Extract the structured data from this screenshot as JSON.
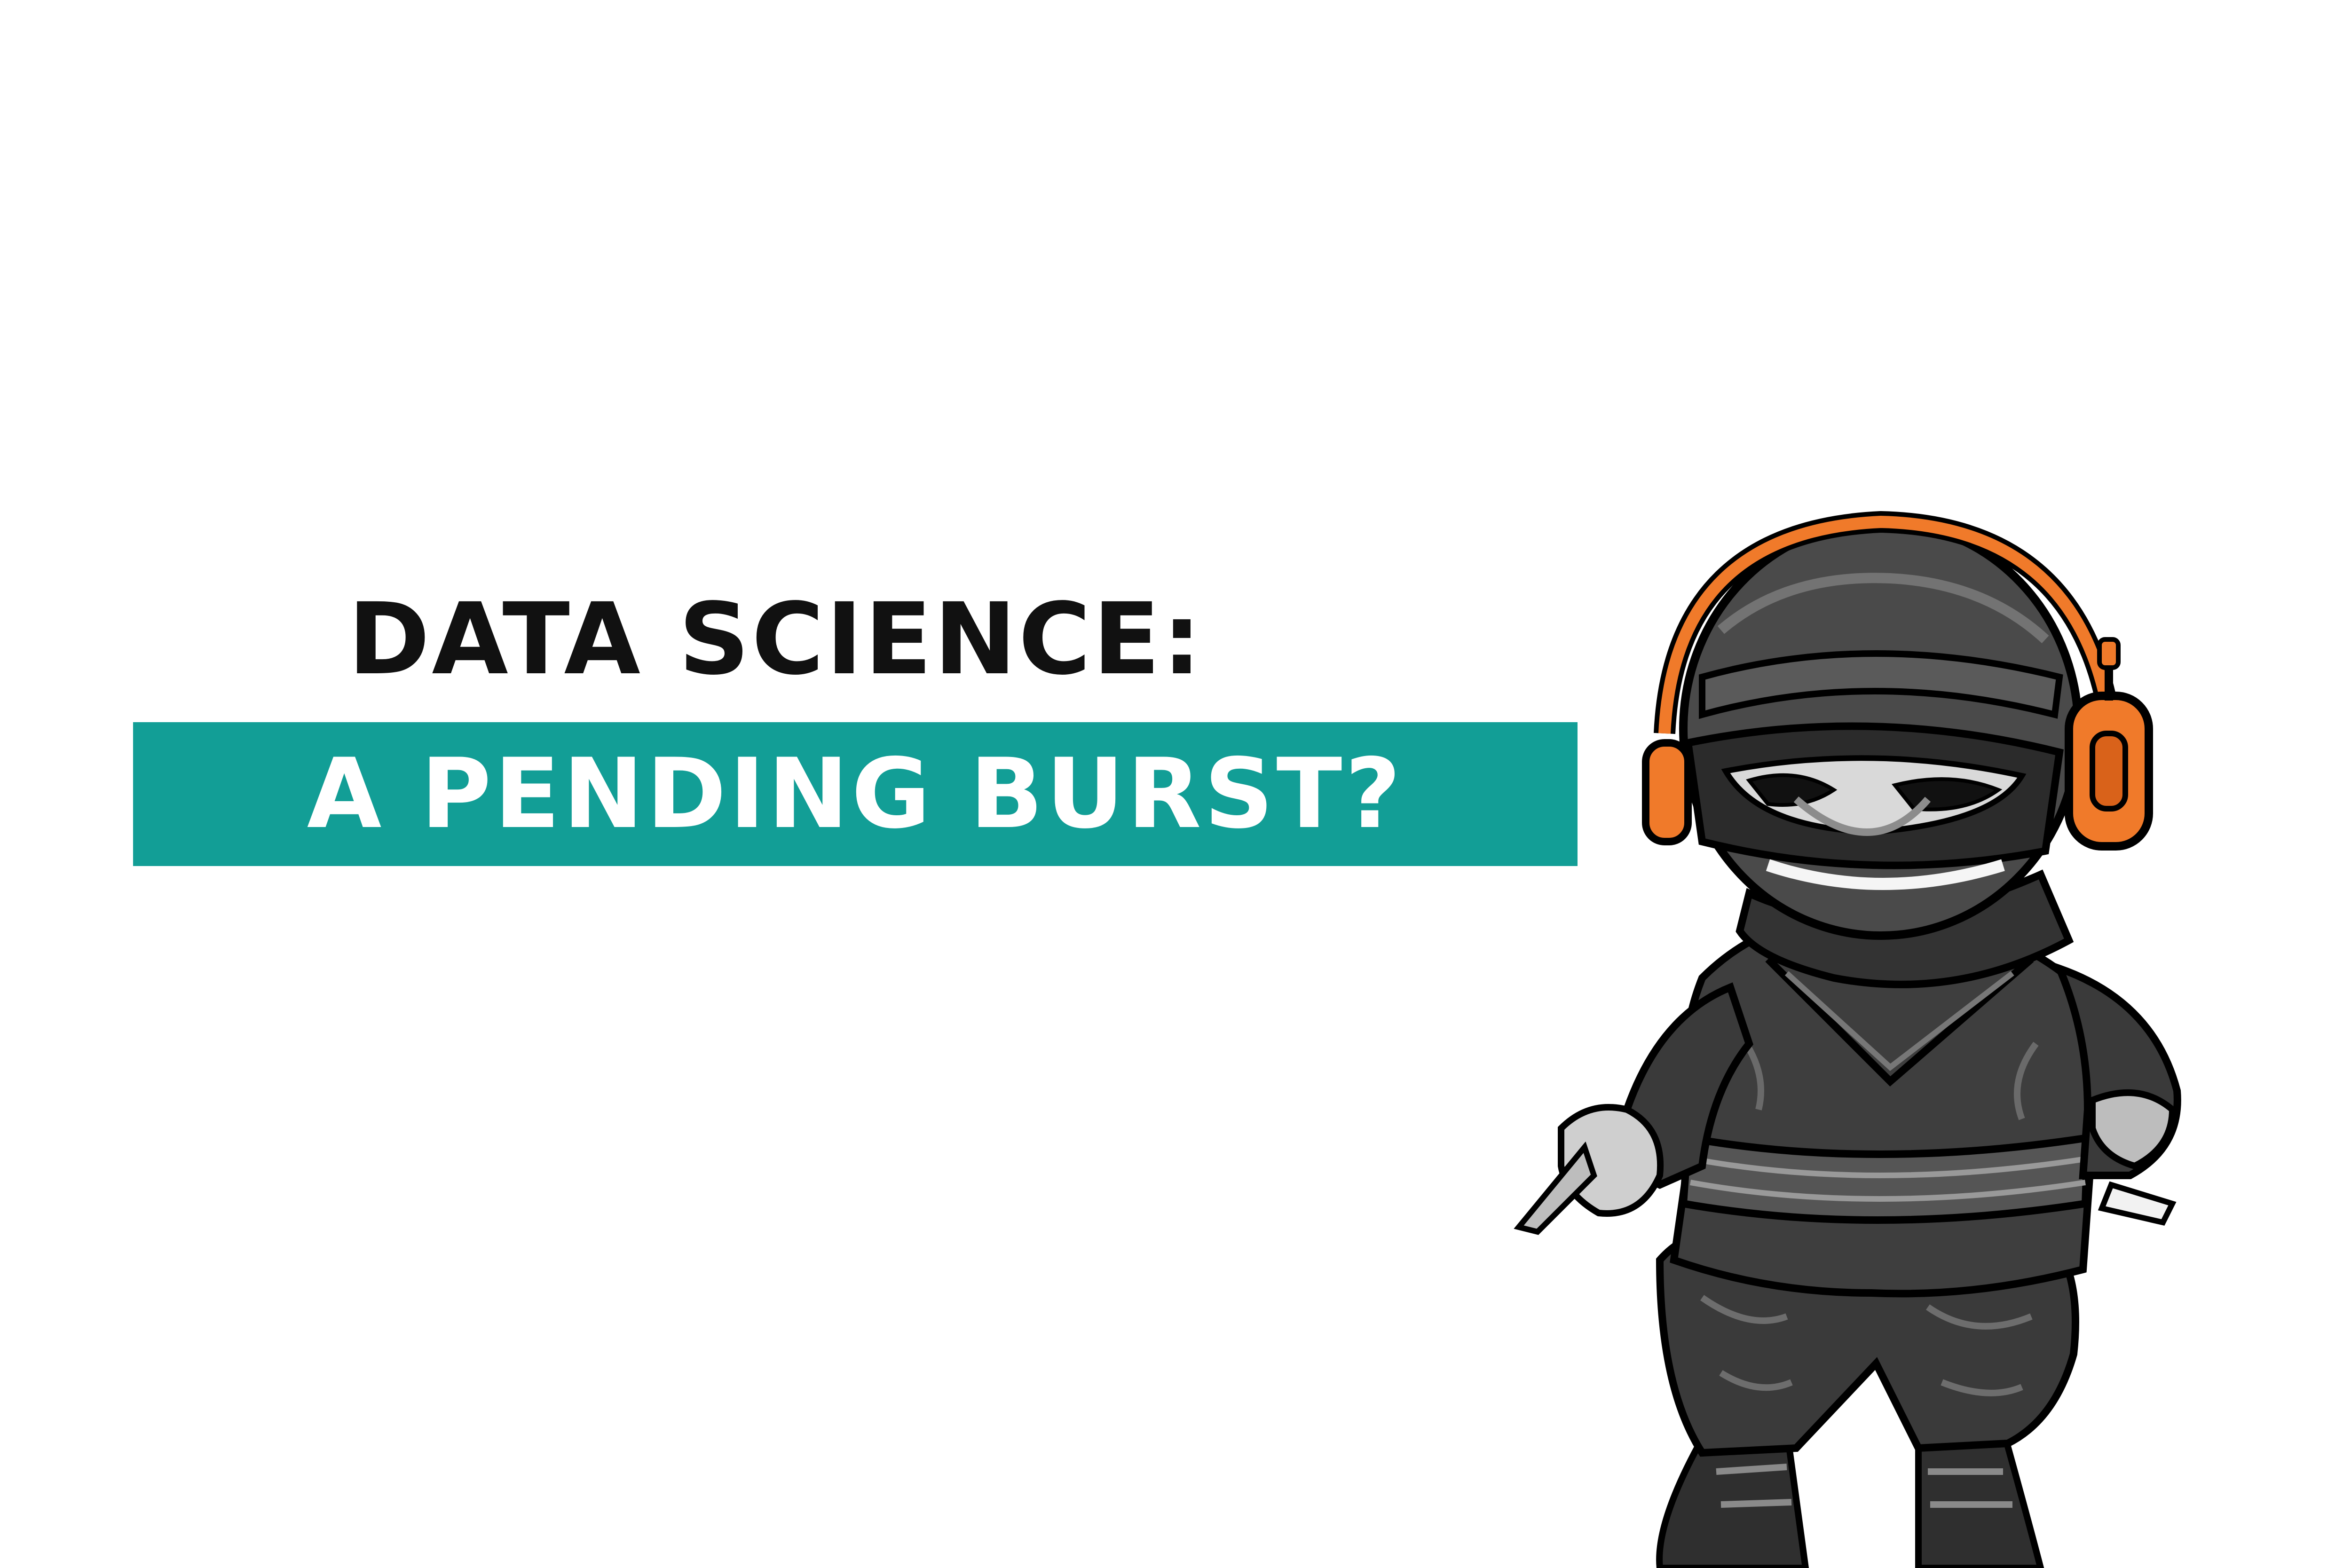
{
  "headline": {
    "line1": "DATA SCIENCE:",
    "line2": "A PENDING BURST?"
  },
  "colors": {
    "background": "#ffffff",
    "text_dark": "#111111",
    "band_teal": "#129e96",
    "band_text": "#ffffff",
    "headphone_orange": "#f07a2a"
  },
  "illustration": {
    "subject": "ninja-mascot-with-headphones-icon"
  }
}
